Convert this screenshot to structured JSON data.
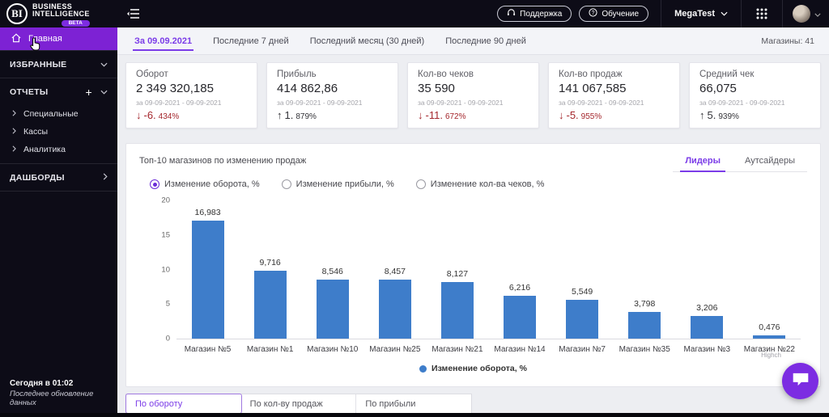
{
  "topbar": {
    "logo": {
      "initials": "BI",
      "line1": "BUSINESS",
      "line2": "INTELLIGENCE",
      "beta": "BETA"
    },
    "support_label": "Поддержка",
    "training_label": "Обучение",
    "account_label": "MegaTest"
  },
  "sidebar": {
    "home": "Главная",
    "favorites": "ИЗБРАННЫЕ",
    "reports": "ОТЧЕТЫ",
    "report_items": [
      "Специальные",
      "Кассы",
      "Аналитика"
    ],
    "dashboards": "ДАШБОРДЫ",
    "last_update_time": "Сегодня в 01:02",
    "last_update_label": "Последнее обновление данных"
  },
  "period_tabs": {
    "items": [
      {
        "label": "За 09.09.2021",
        "active": true
      },
      {
        "label": "Последние 7 дней",
        "active": false
      },
      {
        "label": "Последний месяц (30 дней)",
        "active": false
      },
      {
        "label": "Последние 90 дней",
        "active": false
      }
    ],
    "stores_count": "Магазины: 41"
  },
  "kpi_cards": [
    {
      "title": "Оборот",
      "value": "2 349 320,185",
      "period": "за 09-09-2021 - 09-09-2021",
      "arrow": "↓",
      "delta_main": "-6.",
      "delta_small": "434%",
      "trend": "neg"
    },
    {
      "title": "Прибыль",
      "value": "414 862,86",
      "period": "за 09-09-2021 - 09-09-2021",
      "arrow": "↑",
      "delta_main": "1.",
      "delta_small": "879%",
      "trend": "pos"
    },
    {
      "title": "Кол-во чеков",
      "value": "35 590",
      "period": "за 09-09-2021 - 09-09-2021",
      "arrow": "↓",
      "delta_main": "-11.",
      "delta_small": "672%",
      "trend": "neg"
    },
    {
      "title": "Кол-во продаж",
      "value": "141 067,585",
      "period": "за 09-09-2021 - 09-09-2021",
      "arrow": "↓",
      "delta_main": "-5.",
      "delta_small": "955%",
      "trend": "neg"
    },
    {
      "title": "Средний чек",
      "value": "66,075",
      "period": "за 09-09-2021 - 09-09-2021",
      "arrow": "↑",
      "delta_main": "5.",
      "delta_small": "939%",
      "trend": "pos"
    }
  ],
  "chart": {
    "title": "Топ-10 магазинов по изменению продаж",
    "tabs": [
      {
        "label": "Лидеры",
        "active": true
      },
      {
        "label": "Аутсайдеры",
        "active": false
      }
    ],
    "radios": [
      {
        "label": "Изменение оборота, %",
        "selected": true
      },
      {
        "label": "Изменение прибыли, %",
        "selected": false
      },
      {
        "label": "Изменение кол-ва чеков, %",
        "selected": false
      }
    ],
    "credit": "Highch"
  },
  "chart_data": {
    "type": "bar",
    "title": "Топ-10 магазинов по изменению продаж",
    "categories": [
      "Магазин №5",
      "Магазин №1",
      "Магазин №10",
      "Магазин №25",
      "Магазин №21",
      "Магазин №14",
      "Магазин №7",
      "Магазин №35",
      "Магазин №3",
      "Магазин №22"
    ],
    "values": [
      16.983,
      9.716,
      8.546,
      8.457,
      8.127,
      6.216,
      5.549,
      3.798,
      3.206,
      0.476
    ],
    "value_labels": [
      "16,983",
      "9,716",
      "8,546",
      "8,457",
      "8,127",
      "6,216",
      "5,549",
      "3,798",
      "3,206",
      "0,476"
    ],
    "series_name": "Изменение оборота, %",
    "ylim": [
      0,
      20
    ],
    "yticks": [
      0,
      5,
      10,
      15,
      20
    ],
    "bar_color": "#3e7dca",
    "grid": false,
    "legend_position": "bottom"
  },
  "bottom_tabs": [
    {
      "label": "По обороту",
      "active": true
    },
    {
      "label": "По кол-ву продаж",
      "active": false
    },
    {
      "label": "По прибыли",
      "active": false
    }
  ]
}
